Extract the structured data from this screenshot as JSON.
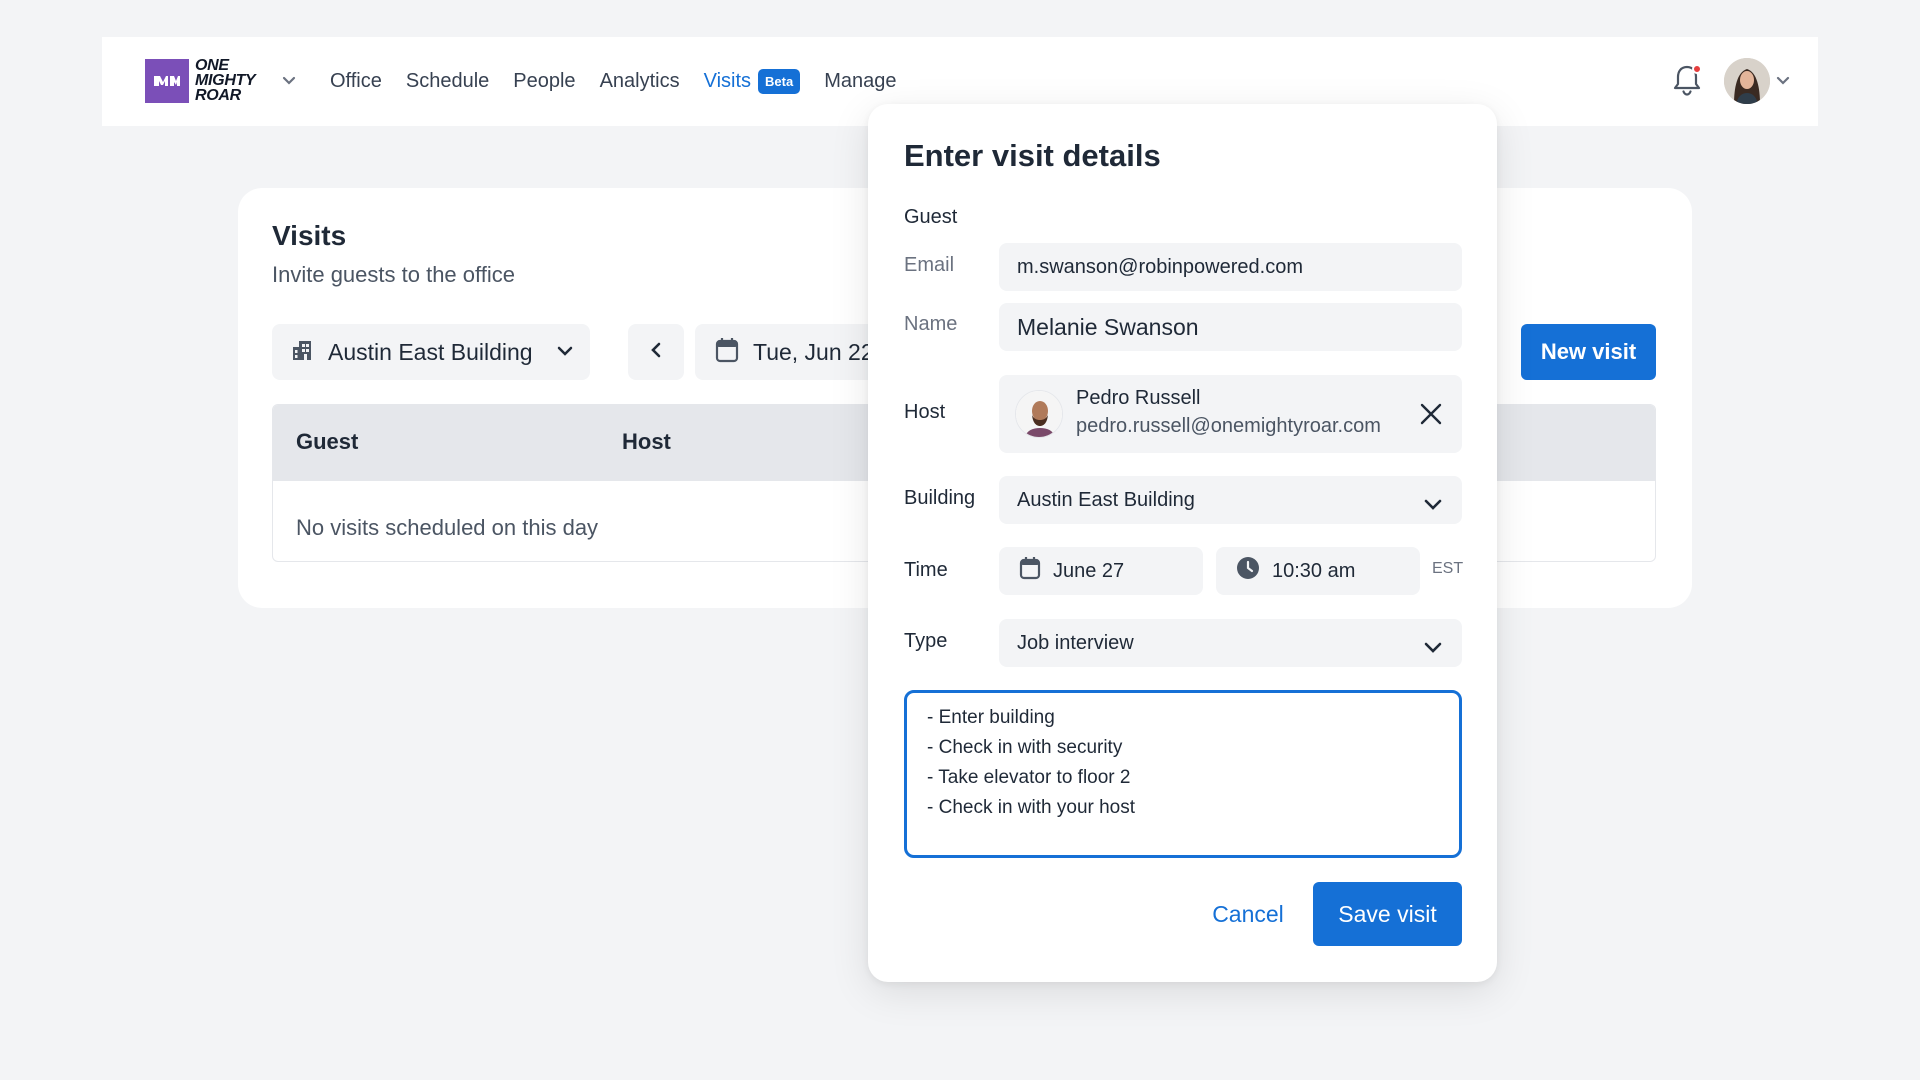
{
  "brand": {
    "name_lines": [
      "ONE",
      "MIGHTY",
      "ROAR"
    ]
  },
  "nav": {
    "links": [
      "Office",
      "Schedule",
      "People",
      "Analytics",
      "Visits",
      "Manage"
    ],
    "active": "Visits",
    "beta_badge": "Beta"
  },
  "icons": {
    "logo": "brand-logo-icon",
    "notification": "bell-icon",
    "building": "building-icon",
    "calendar": "calendar-icon",
    "clock": "clock-icon",
    "close": "close-icon",
    "chevron": "chevron-down-icon",
    "back": "chevron-left-icon"
  },
  "colors": {
    "accent": "#1570d6",
    "brand": "#7b4fb8",
    "notification_dot": "#e53e3e"
  },
  "page": {
    "title": "Visits",
    "subtitle": "Invite guests to the office",
    "building_select": "Austin East Building",
    "date": "Tue, Jun 22",
    "new_visit": "New visit",
    "table_headers": [
      "Guest",
      "Host"
    ],
    "empty_message": "No visits scheduled on this day"
  },
  "modal": {
    "title": "Enter visit details",
    "guest_section": "Guest",
    "email_label": "Email",
    "email_value": "m.swanson@robinpowered.com",
    "name_label": "Name",
    "name_value": "Melanie Swanson",
    "host_label": "Host",
    "host_name": "Pedro Russell",
    "host_email": "pedro.russell@onemightyroar.com",
    "building_label": "Building",
    "building_value": "Austin East Building",
    "time_label": "Time",
    "date_value": "June 27",
    "time_value": "10:30 am",
    "timezone": "EST",
    "type_label": "Type",
    "type_value": "Job interview",
    "notes_lines": [
      "- Enter building",
      "- Check in with security",
      "- Take elevator to floor 2",
      "- Check in with your host"
    ],
    "cancel": "Cancel",
    "save": "Save visit"
  }
}
